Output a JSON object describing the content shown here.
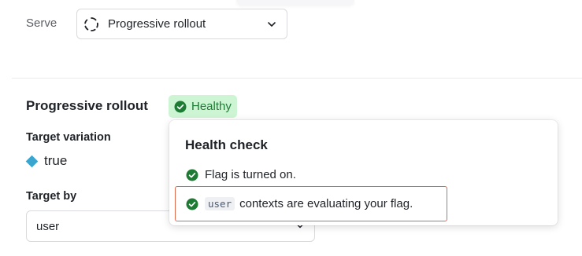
{
  "serve": {
    "label": "Serve",
    "selected": "Progressive rollout",
    "icon": "progressive-rollout-icon"
  },
  "rollout": {
    "title": "Progressive rollout",
    "status_badge": "Healthy",
    "status_color": "#1e7b34"
  },
  "target_variation": {
    "label": "Target variation",
    "value": "true",
    "color": "#3aa6d0"
  },
  "target_by": {
    "label": "Target by",
    "value": "user"
  },
  "health_check": {
    "title": "Health check",
    "items": [
      {
        "text": "Flag is turned on."
      },
      {
        "code": "user",
        "text": "contexts are evaluating your flag."
      }
    ]
  }
}
